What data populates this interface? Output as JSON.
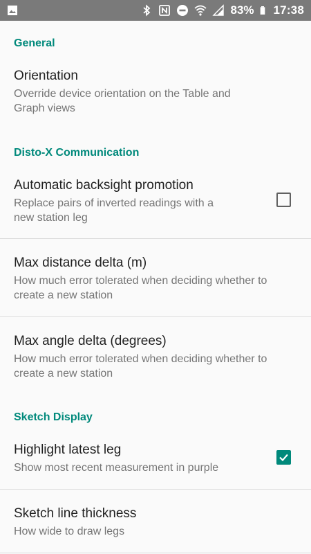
{
  "statusbar": {
    "battery_percent": "83%",
    "time": "17:38",
    "icons": [
      "image-icon",
      "bluetooth-icon",
      "nfc-icon",
      "do-not-disturb-icon",
      "wifi-icon",
      "signal-icon",
      "battery-icon"
    ]
  },
  "sections": {
    "general": "General",
    "disto": "Disto-X Communication",
    "sketch": "Sketch Display"
  },
  "prefs": {
    "orientation": {
      "title": "Orientation",
      "summary": "Override device orientation on the Table and Graph views"
    },
    "backsight": {
      "title": "Automatic backsight promotion",
      "summary": "Replace pairs of inverted readings with a new station leg",
      "checked": false
    },
    "max_distance": {
      "title": "Max distance delta (m)",
      "summary": "How much error tolerated when deciding whether to create a new station"
    },
    "max_angle": {
      "title": "Max angle delta (degrees)",
      "summary": "How much error tolerated when deciding whether to create a new station"
    },
    "highlight": {
      "title": "Highlight latest leg",
      "summary": "Show most recent measurement in purple",
      "checked": true
    },
    "line_thickness": {
      "title": "Sketch line thickness",
      "summary": "How wide to draw legs"
    }
  },
  "colors": {
    "accent": "#00897b",
    "statusbar": "#7a7a7a"
  }
}
